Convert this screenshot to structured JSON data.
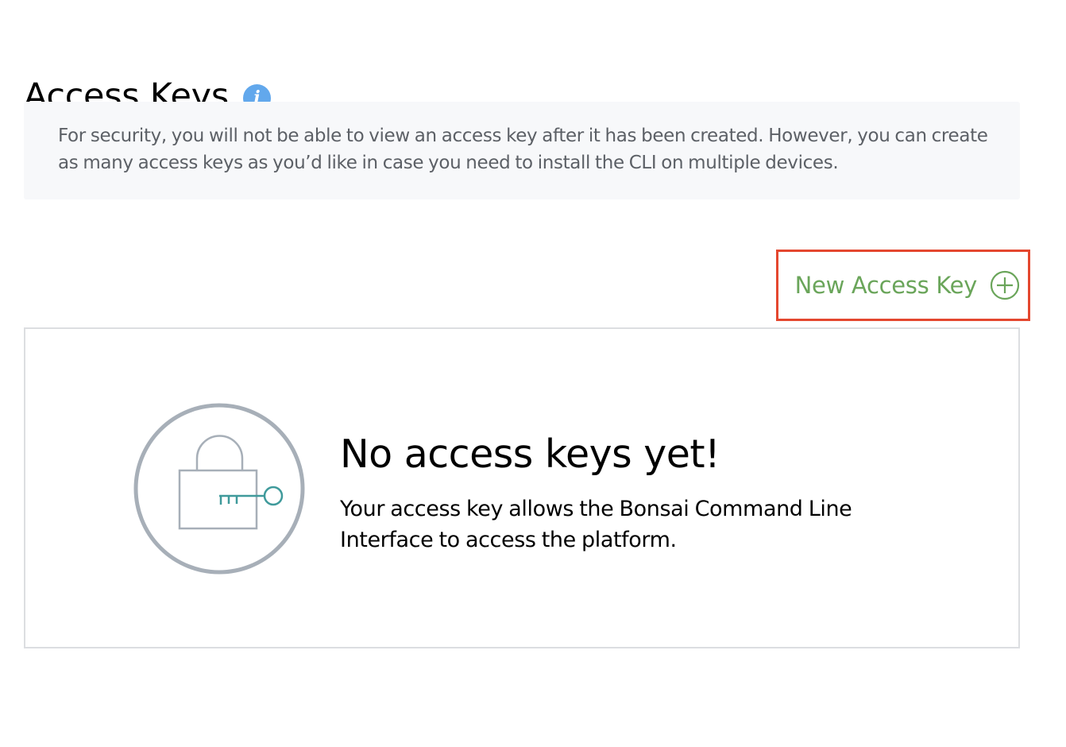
{
  "header": {
    "title": "Access Keys",
    "info_icon": "info-icon",
    "info_icon_glyph": "i"
  },
  "notice": {
    "text": "For security, you will not be able to view an access key after it has been created. However, you can create as many access keys as you’d like in case you need to install the CLI on multiple devices."
  },
  "actions": {
    "new_key_label": "New Access Key",
    "new_key_icon": "plus-circle-icon",
    "highlight_color": "#e4472f",
    "label_color": "#6aa55a"
  },
  "empty_state": {
    "illustration_icon": "lock-key-icon",
    "heading": "No access keys yet!",
    "description": "Your access key allows the Bonsai Command Line Interface to access the platform.",
    "key_color": "#3f9a9b",
    "lock_color": "#a7afb8"
  },
  "colors": {
    "info_accent": "#62a8ec",
    "notice_background": "#f7f8fa",
    "panel_border": "#dcdee1"
  }
}
